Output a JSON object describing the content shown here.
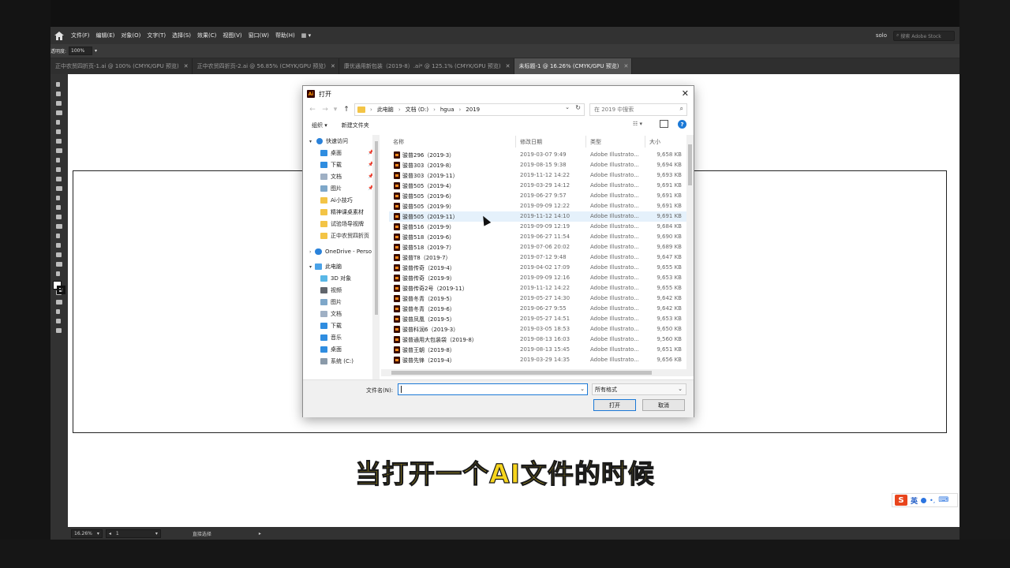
{
  "menubar": {
    "items": [
      "文件(F)",
      "编辑(E)",
      "对象(O)",
      "文字(T)",
      "选择(S)",
      "效果(C)",
      "视图(V)",
      "窗口(W)",
      "帮助(H)"
    ],
    "workspace": "solo",
    "stock_search_placeholder": "搜索 Adobe Stock"
  },
  "controlbar": {
    "opacity_label": "透明度:",
    "opacity_value": "100%"
  },
  "tabs": [
    {
      "label": "正中农贸四折页-1.ai @ 100% (CMYK/GPU 预览)",
      "active": false
    },
    {
      "label": "正中农贸四折页-2.ai @ 56.85% (CMYK/GPU 预览)",
      "active": false
    },
    {
      "label": "康优通用新包装（2019-8）.ai* @ 125.1% (CMYK/GPU 预览)",
      "active": false
    },
    {
      "label": "未标题-1 @ 16.26% (CMYK/GPU 预览)",
      "active": true
    }
  ],
  "statusbar": {
    "zoom": "16.26%",
    "artboard": "1",
    "tool": "直接选择"
  },
  "dialog": {
    "title": "打开",
    "breadcrumbs": [
      "此电脑",
      "文档 (D:)",
      "hgua",
      "2019"
    ],
    "search_placeholder": "在 2019 中搜索",
    "organize_label": "组织",
    "new_folder_label": "新建文件夹",
    "columns": {
      "name": "名称",
      "date": "修改日期",
      "type": "类型",
      "size": "大小"
    },
    "nav": {
      "quick_access": "快速访问",
      "quick_items": [
        "桌面",
        "下载",
        "文档",
        "图片",
        "Ai小技巧",
        "精神课桌素材",
        "试验场导视牌",
        "正中农贸四折页"
      ],
      "onedrive": "OneDrive - Perso",
      "this_pc": "此电脑",
      "pc_items": [
        "3D 对象",
        "视频",
        "图片",
        "文档",
        "下载",
        "音乐",
        "桌面",
        "系统 (C:)"
      ]
    },
    "files": [
      {
        "name": "骏普296（2019-3）",
        "date": "2019-03-07 9:49",
        "type": "Adobe Illustrato...",
        "size": "9,658 KB"
      },
      {
        "name": "骏普303（2019-8）",
        "date": "2019-08-15 9:38",
        "type": "Adobe Illustrato...",
        "size": "9,694 KB"
      },
      {
        "name": "骏普303（2019-11）",
        "date": "2019-11-12 14:22",
        "type": "Adobe Illustrato...",
        "size": "9,693 KB"
      },
      {
        "name": "骏普505（2019-4）",
        "date": "2019-03-29 14:12",
        "type": "Adobe Illustrato...",
        "size": "9,691 KB"
      },
      {
        "name": "骏普505（2019-6）",
        "date": "2019-06-27 9:57",
        "type": "Adobe Illustrato...",
        "size": "9,691 KB"
      },
      {
        "name": "骏普505（2019-9）",
        "date": "2019-09-09 12:22",
        "type": "Adobe Illustrato...",
        "size": "9,691 KB"
      },
      {
        "name": "骏普505（2019-11）",
        "date": "2019-11-12 14:10",
        "type": "Adobe Illustrato...",
        "size": "9,691 KB"
      },
      {
        "name": "骏普516（2019-9）",
        "date": "2019-09-09 12:19",
        "type": "Adobe Illustrato...",
        "size": "9,684 KB"
      },
      {
        "name": "骏普518（2019-6）",
        "date": "2019-06-27 11:54",
        "type": "Adobe Illustrato...",
        "size": "9,690 KB"
      },
      {
        "name": "骏普518（2019-7）",
        "date": "2019-07-06 20:02",
        "type": "Adobe Illustrato...",
        "size": "9,689 KB"
      },
      {
        "name": "骏普T8（2019-7）",
        "date": "2019-07-12 9:48",
        "type": "Adobe Illustrato...",
        "size": "9,647 KB"
      },
      {
        "name": "骏普传奇（2019-4）",
        "date": "2019-04-02 17:09",
        "type": "Adobe Illustrato...",
        "size": "9,655 KB"
      },
      {
        "name": "骏普传奇（2019-9）",
        "date": "2019-09-09 12:16",
        "type": "Adobe Illustrato...",
        "size": "9,653 KB"
      },
      {
        "name": "骏普传奇2号（2019-11）",
        "date": "2019-11-12 14:22",
        "type": "Adobe Illustrato...",
        "size": "9,655 KB"
      },
      {
        "name": "骏普冬青（2019-5）",
        "date": "2019-05-27 14:30",
        "type": "Adobe Illustrato...",
        "size": "9,642 KB"
      },
      {
        "name": "骏普冬青（2019-6）",
        "date": "2019-06-27 9:55",
        "type": "Adobe Illustrato...",
        "size": "9,642 KB"
      },
      {
        "name": "骏普凤凰（2019-5）",
        "date": "2019-05-27 14:51",
        "type": "Adobe Illustrato...",
        "size": "9,653 KB"
      },
      {
        "name": "骏普科润6（2019-3）",
        "date": "2019-03-05 18:53",
        "type": "Adobe Illustrato...",
        "size": "9,650 KB"
      },
      {
        "name": "骏普通用大包装袋（2019-8）",
        "date": "2019-08-13 16:03",
        "type": "Adobe Illustrato...",
        "size": "9,560 KB"
      },
      {
        "name": "骏普王朝（2019-8）",
        "date": "2019-08-13 15:45",
        "type": "Adobe Illustrato...",
        "size": "9,651 KB"
      },
      {
        "name": "骏普先锋（2019-4）",
        "date": "2019-03-29 14:35",
        "type": "Adobe Illustrato...",
        "size": "9,656 KB"
      }
    ],
    "hover_index": 6,
    "filename_label": "文件名(N):",
    "filename_value": "",
    "filetype_value": "所有格式",
    "open_label": "打开",
    "cancel_label": "取消"
  },
  "caption": "当打开一个AI文件的时候",
  "ime": {
    "logo": "S",
    "lang": "英"
  },
  "colors": {
    "caption": "#f7d51d",
    "app_bg": "#535353",
    "accent": "#1c79d6",
    "ai_icon": "#ff8a1d"
  },
  "icons": [
    "home-icon",
    "search-icon",
    "close-icon",
    "folder-icon",
    "refresh-icon",
    "help-icon",
    "ai-file-icon",
    "pin-icon"
  ]
}
